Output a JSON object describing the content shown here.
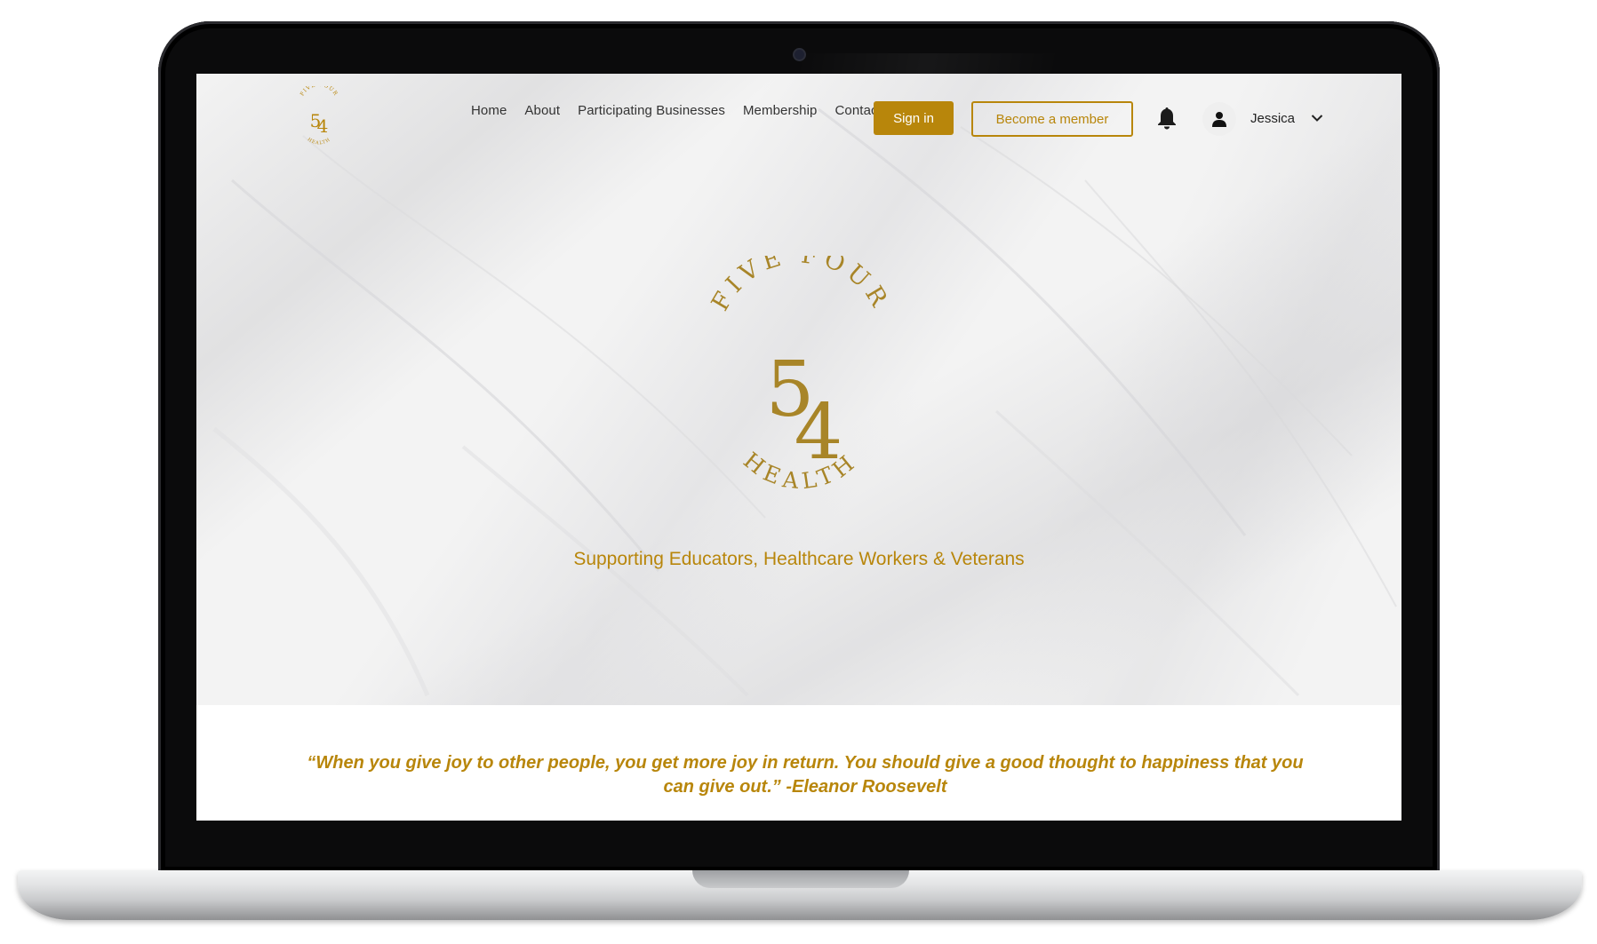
{
  "brand": {
    "logo_top": "FIVE FOUR",
    "logo_digits": "54",
    "logo_bottom": "HEALTH",
    "accent_color": "#b8860b"
  },
  "nav": {
    "items": [
      {
        "label": "Home"
      },
      {
        "label": "About"
      },
      {
        "label": "Participating Businesses"
      },
      {
        "label": "Membership"
      },
      {
        "label": "Contact"
      }
    ],
    "signin_label": "Sign in",
    "member_label": "Become a member"
  },
  "user": {
    "name": "Jessica",
    "notification_icon": "bell-icon",
    "avatar_icon": "user-icon",
    "menu_icon": "chevron-down-icon"
  },
  "hero": {
    "tagline": "Supporting Educators, Healthcare Workers & Veterans"
  },
  "quote": {
    "text": "“When you give joy to other people, you get more joy in return. You should give a good thought to happiness that you can give out.” -Eleanor Roosevelt"
  }
}
